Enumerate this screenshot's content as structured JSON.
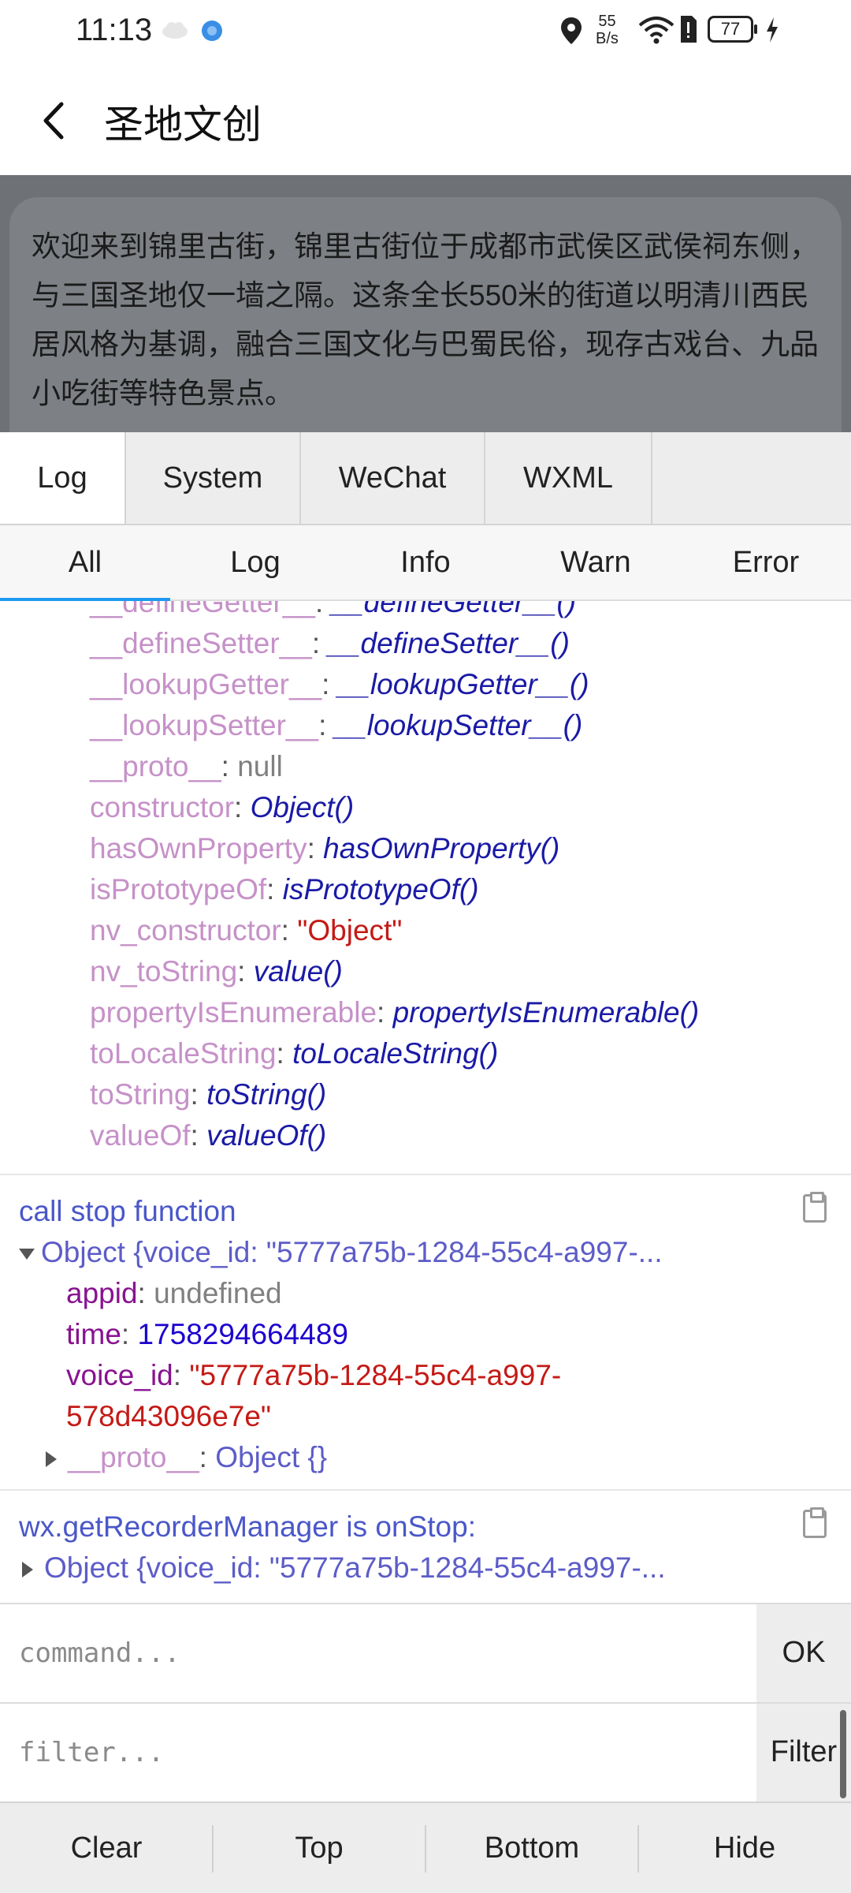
{
  "status_bar": {
    "time": "11:13",
    "net_speed_value": "55",
    "net_speed_unit": "B/s",
    "battery": "77"
  },
  "header": {
    "title": "圣地文创"
  },
  "intro_text": "欢迎来到锦里古街，锦里古街位于成都市武侯区武侯祠东侧，与三国圣地仅一墙之隔。这条全长550米的街道以明清川西民居风格为基调，融合三国文化与巴蜀民俗，现存古戏台、九品小吃街等特色景点。",
  "tabs": [
    "Log",
    "System",
    "WeChat",
    "WXML"
  ],
  "subtabs": [
    "All",
    "Log",
    "Info",
    "Warn",
    "Error"
  ],
  "log": {
    "proto_entries": [
      {
        "key": "__defineGetter__",
        "value": "__defineGetter__()"
      },
      {
        "key": "__defineSetter__",
        "value": "__defineSetter__()"
      },
      {
        "key": "__lookupGetter__",
        "value": "__lookupGetter__()"
      },
      {
        "key": "__lookupSetter__",
        "value": "__lookupSetter__()"
      },
      {
        "key": "__proto__",
        "value": "null"
      },
      {
        "key": "constructor",
        "value": "Object()"
      },
      {
        "key": "hasOwnProperty",
        "value": "hasOwnProperty()"
      },
      {
        "key": "isPrototypeOf",
        "value": "isPrototypeOf()"
      },
      {
        "key": "nv_constructor",
        "value": "\"Object\""
      },
      {
        "key": "nv_toString",
        "value": "value()"
      },
      {
        "key": "propertyIsEnumerable",
        "value": "propertyIsEnumerable()"
      },
      {
        "key": "toLocaleString",
        "value": "toLocaleString()"
      },
      {
        "key": "toString",
        "value": "toString()"
      },
      {
        "key": "valueOf",
        "value": "valueOf()"
      }
    ],
    "entry1": {
      "message": "call stop function",
      "object_summary": "Object {voice_id: \"5777a75b-1284-55c4-a997-...",
      "appid_key": "appid",
      "appid_value": "undefined",
      "time_key": "time",
      "time_value": "1758294664489",
      "voice_id_key": "voice_id",
      "voice_id_value_1": "\"5777a75b-1284-55c4-a997-",
      "voice_id_value_2": "578d43096e7e\"",
      "proto_key": "__proto__",
      "proto_value": "Object {}"
    },
    "entry2": {
      "message": "wx.getRecorderManager is onStop:",
      "object_summary": "Object {voice_id: \"5777a75b-1284-55c4-a997-..."
    }
  },
  "command": {
    "placeholder": "command...",
    "button": "OK"
  },
  "filter": {
    "placeholder": "filter...",
    "button": "Filter"
  },
  "toolbar": [
    "Clear",
    "Top",
    "Bottom",
    "Hide"
  ]
}
